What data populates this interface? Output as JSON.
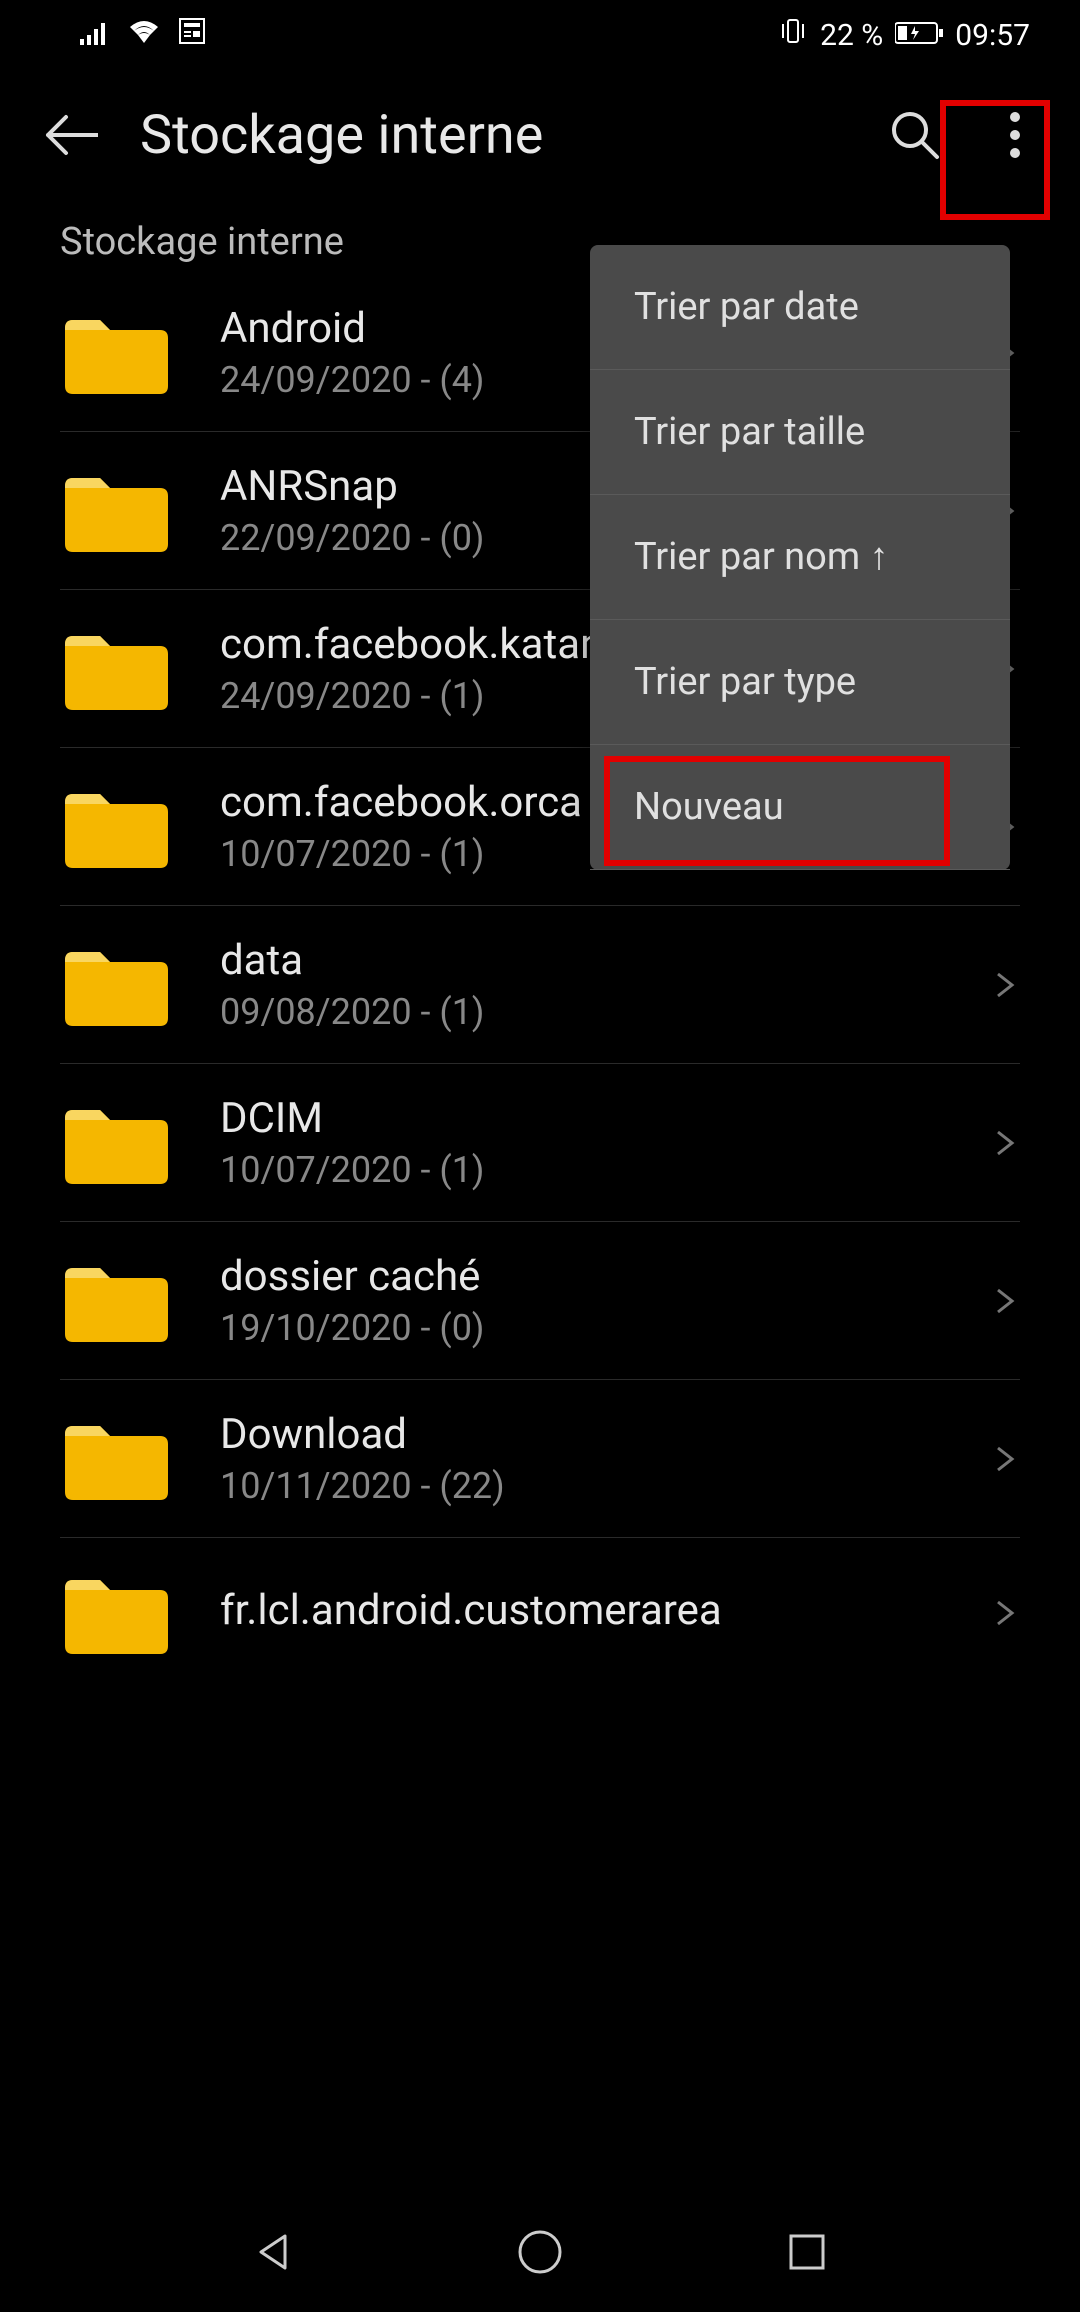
{
  "status": {
    "battery_pct": "22 %",
    "time": "09:57"
  },
  "header": {
    "title": "Stockage interne"
  },
  "breadcrumb": "Stockage interne",
  "menu": {
    "items": [
      "Trier par date",
      "Trier par taille",
      "Trier par nom ↑",
      "Trier par type",
      "Nouveau"
    ]
  },
  "folders": [
    {
      "name": "Android",
      "meta": "24/09/2020 -  (4)"
    },
    {
      "name": "ANRSnap",
      "meta": "22/09/2020 -  (0)"
    },
    {
      "name": "com.facebook.katana",
      "meta": "24/09/2020 -  (1)"
    },
    {
      "name": "com.facebook.orca",
      "meta": "10/07/2020 -  (1)"
    },
    {
      "name": "data",
      "meta": "09/08/2020 -  (1)"
    },
    {
      "name": "DCIM",
      "meta": "10/07/2020 -  (1)"
    },
    {
      "name": "dossier caché",
      "meta": "19/10/2020 -  (0)"
    },
    {
      "name": "Download",
      "meta": "10/11/2020 -  (22)"
    },
    {
      "name": "fr.lcl.android.customerarea",
      "meta": ""
    }
  ]
}
